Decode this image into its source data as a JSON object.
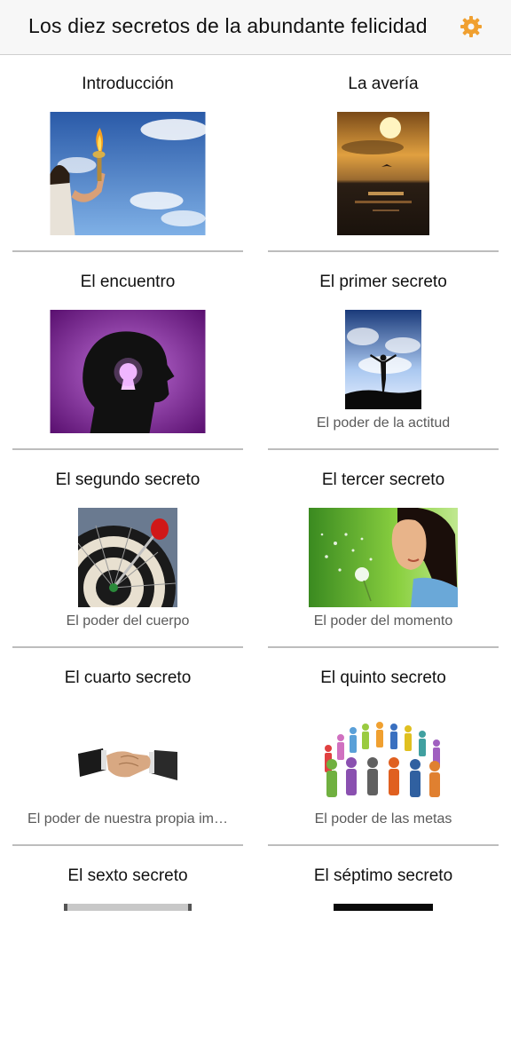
{
  "header": {
    "title": "Los diez secretos de la abundante felicidad",
    "settings_icon": "gear-icon",
    "accent_color": "#f0a030"
  },
  "items": [
    {
      "title": "Introducción",
      "subtitle": "",
      "image": "torch-photo"
    },
    {
      "title": "La avería",
      "subtitle": "",
      "image": "sunset-sea-photo"
    },
    {
      "title": "El encuentro",
      "subtitle": "",
      "image": "keyhole-head-photo"
    },
    {
      "title": "El primer secreto",
      "subtitle": "El poder de la actitud",
      "image": "man-sky-photo"
    },
    {
      "title": "El segundo secreto",
      "subtitle": "El poder del cuerpo",
      "image": "dartboard-photo"
    },
    {
      "title": "El tercer secreto",
      "subtitle": "El poder del momento",
      "image": "dandelion-woman-photo"
    },
    {
      "title": "El cuarto secreto",
      "subtitle": "El poder de nuestra propia im…",
      "image": "handshake-photo"
    },
    {
      "title": "El quinto secreto",
      "subtitle": "El poder de las metas",
      "image": "people-circle-photo"
    },
    {
      "title": "El sexto secreto",
      "subtitle": "",
      "image": "partial-photo"
    },
    {
      "title": "El séptimo secreto",
      "subtitle": "",
      "image": "partial-photo"
    }
  ]
}
